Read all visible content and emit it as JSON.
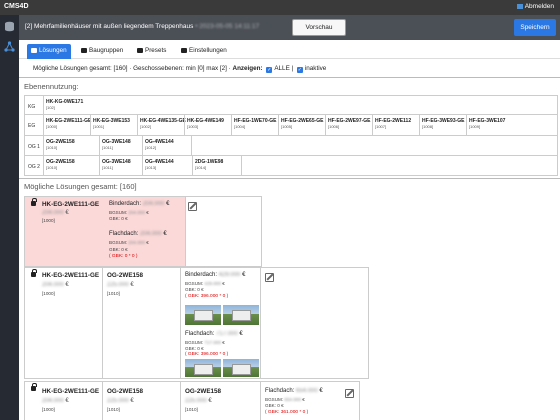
{
  "app": {
    "brand": "CMS4D",
    "logout": "Abmelden"
  },
  "header": {
    "title": "[2] Mehrfamilienhäuser mit außen liegendem Treppenhaus",
    "title_suffix": "• 2023-05-05 14:11:17",
    "preview_label": "Vorschau",
    "save_label": "Speichern"
  },
  "tabs": [
    "Lösungen",
    "Baugruppen",
    "Presets",
    "Einstellungen"
  ],
  "filter": {
    "text": "Mögliche Lösungen gesamt: [160] · Geschossebenen: min [0] max [2] ·",
    "label": "Anzeigen:",
    "opt1": "ALLE |",
    "opt2": "inaktive"
  },
  "ebenen": {
    "heading": "Ebenennutzung:",
    "rows": [
      {
        "label": "KG",
        "cells": [
          {
            "n": "HK-KG-0WE171",
            "s": "[102]"
          }
        ]
      },
      {
        "label": "EG",
        "cells": [
          {
            "n": "HK-EG-2WE111-GE",
            "s": "[1000]"
          },
          {
            "n": "HK-EG-3WE153",
            "s": "[1001]"
          },
          {
            "n": "HK-EG-4WE135-GE",
            "s": "[1002]"
          },
          {
            "n": "HK-EG-4WE149",
            "s": "[1003]"
          },
          {
            "n": "HF-EG-1WE70-GE",
            "s": "[1004]"
          },
          {
            "n": "HF-EG-2WE65-GE",
            "s": "[1005]"
          },
          {
            "n": "HF-EG-2WE97-GE",
            "s": "[1006]"
          },
          {
            "n": "HF-EG-2WE112",
            "s": "[1007]"
          },
          {
            "n": "HF-EG-3WE93-GE",
            "s": "[1008]"
          },
          {
            "n": "HF-EG-3WE107",
            "s": "[1009]"
          }
        ]
      },
      {
        "label": "OG 1",
        "cells": [
          {
            "n": "OG-2WE158",
            "s": "[1010]"
          },
          {
            "n": "OG-3WE148",
            "s": "[1011]"
          },
          {
            "n": "OG-4WE144",
            "s": "[1012]"
          }
        ]
      },
      {
        "label": "OG 2",
        "cells": [
          {
            "n": "OG-2WE158",
            "s": "[1010]"
          },
          {
            "n": "OG-3WE148",
            "s": "[1011]"
          },
          {
            "n": "OG-4WE144",
            "s": "[1013]"
          },
          {
            "n": "2DG-1WE98",
            "s": "[1014]"
          }
        ]
      }
    ]
  },
  "solutions": {
    "heading": "Mögliche Lösungen gesamt: [160]",
    "card1": {
      "name": "HK-EG-2WE111-GE",
      "price": "204.000",
      "id": "[1000]",
      "b_label": "Binderdach:",
      "b_price": "204.000",
      "bgsum": "BGSUM:",
      "bgsum_val": "204.000",
      "gbk": "GBK: 0 €",
      "gbk_red": "( GBK: 0 * 0 )",
      "f_label": "Flachdach:",
      "f_price": "204.000",
      "f_bgsum_val": "204.000",
      "f_gbk": "GBK: 0 €",
      "f_gbk_red": "( GBK: 0 * 0 )"
    },
    "card2": {
      "c1_name": "HK-EG-2WE111-GE",
      "c1_price": "204.000",
      "c1_id": "[1000]",
      "c2_name": "OG-2WE158",
      "c2_price": "225.000",
      "c2_id": "[1010]",
      "b_label": "Binderdach:",
      "b_price": "429.000",
      "bgsum": "BGSUM:",
      "bgsum_val": "429.000",
      "gbk": "GBK: 0 €",
      "gbk_red": "( GBK: 396.000 * 0 )",
      "f_label": "Flachdach:",
      "f_price": "717.000",
      "f_bgsum_val": "717.000",
      "f_gbk": "GBK: 0 €",
      "f_gbk_red": "( GBK: 396.000 * 0 )"
    },
    "card3": {
      "c1_name": "HK-EG-2WE111-GE",
      "c1_price": "204.000",
      "c1_id": "[1000]",
      "c2_name": "OG-2WE158",
      "c2_price": "225.000",
      "c2_id": "[1010]",
      "c3_name": "OG-2WE158",
      "c3_price": "225.000",
      "c3_id": "[1010]",
      "f_label": "Flachdach:",
      "f_price": "654.000",
      "bgsum": "BGSUM:",
      "bgsum_val": "654.000",
      "gbk": "GBK: 0 €",
      "gbk_red": "( GBK: 361.000 * 0 )"
    },
    "euro": "€"
  },
  "colors": {
    "accent": "#2b78e4",
    "topbar": "#3a3a3a",
    "titlebar": "#4b4f56",
    "error_bg": "#fbd9d9"
  },
  "icons": [
    "database-icon",
    "network-icon",
    "lock-icon",
    "edit-icon",
    "checkbox-icon"
  ]
}
